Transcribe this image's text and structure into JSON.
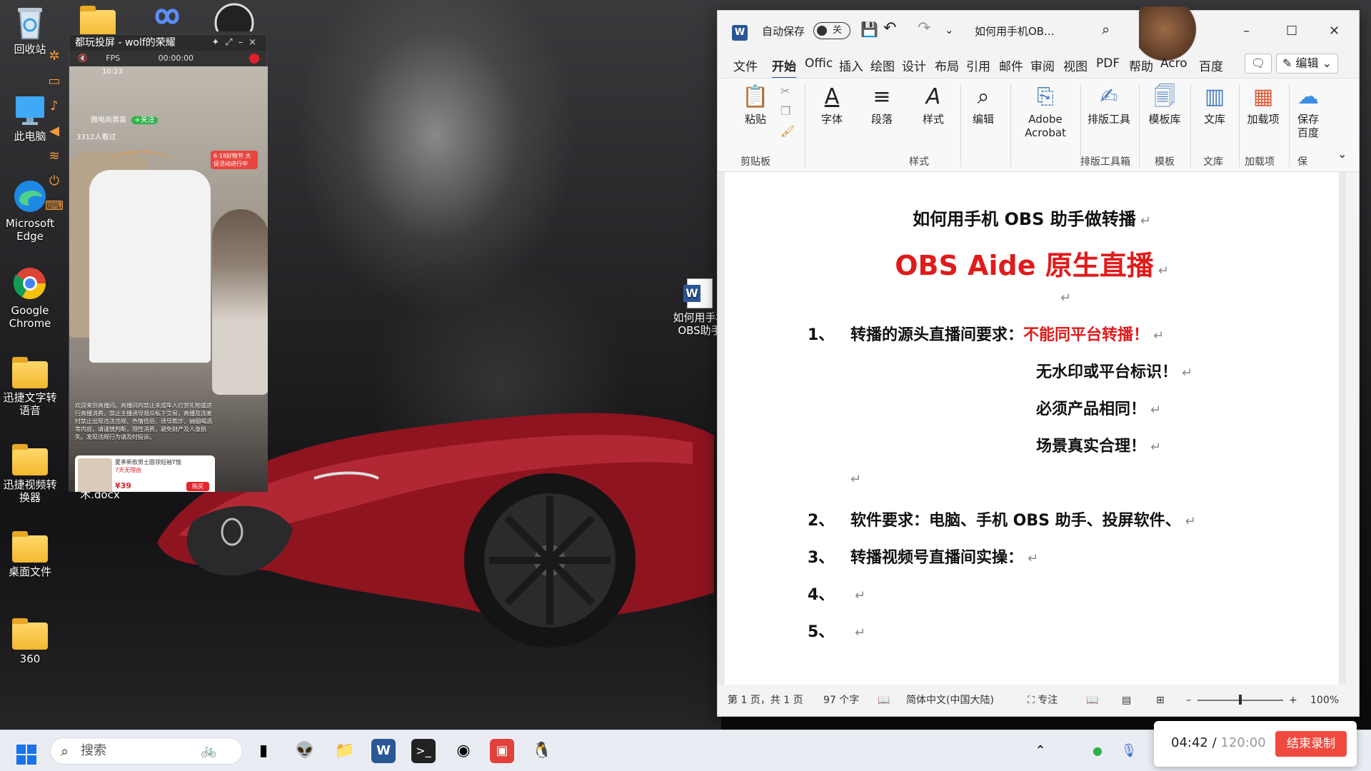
{
  "desktop": {
    "icons": [
      {
        "label": "回收站",
        "name": "recycle-bin"
      },
      {
        "label": "此电脑",
        "name": "this-pc"
      },
      {
        "label": "Microsoft Edge",
        "name": "edge"
      },
      {
        "label": "Google Chrome",
        "name": "chrome"
      },
      {
        "label": "迅捷文字转语音",
        "name": "folder-tts"
      },
      {
        "label": "迅捷视频转换器",
        "name": "folder-video"
      },
      {
        "label": "桌面文件",
        "name": "folder-desktop"
      },
      {
        "label": "360",
        "name": "folder-360"
      },
      {
        "label": "如何用手机OBS助手",
        "name": "word-doc"
      },
      {
        "label": "技巧话术.docx",
        "name": "docx-file"
      }
    ]
  },
  "mirror": {
    "title": "都玩投屏 - wolf的荣耀",
    "timer": "00:00:00",
    "fps": "FPS",
    "phone_time": "10:23",
    "streamer": "微电尚男装",
    "follow": "+关注",
    "viewers": "3312人看过",
    "promo": "6·18好物节 大促活动进行中",
    "notice": "欢迎来到直播间。直播间内禁止未成年人打赏礼物或进行直播消费，禁止主播诱导观众私下交易，直播及连麦时禁止出现违法违规、色情低俗、诱导欺诈、抽烟喝酒等内容。请谨慎判断，理性消费，避免财产及人身损失。发现违规行为请及时投诉。",
    "product_title": "夏季新款男士圆领短袖T恤",
    "product_sub": "7天无理由",
    "price": "¥39",
    "buy": "购买"
  },
  "word": {
    "autosave": "自动保存",
    "autosave_state": "关",
    "doc_name": "如何用手机OB...",
    "tabs": [
      "文件",
      "开始",
      "Offic",
      "插入",
      "绘图",
      "设计",
      "布局",
      "引用",
      "邮件",
      "审阅",
      "视图",
      "PDF",
      "帮助",
      "Acro",
      "百度"
    ],
    "edit_label": "编辑",
    "ribbon": {
      "paste": "粘贴",
      "font": "字体",
      "paragraph": "段落",
      "styles": "样式",
      "editing": "编辑",
      "acrobat": "Adobe Acrobat",
      "layout_tool": "排版工具",
      "template_lib": "模板库",
      "library": "文库",
      "addin": "加载项",
      "save_baidu": "保存百度",
      "groups": [
        "剪贴板",
        "样式",
        "排版工具箱",
        "模板",
        "文库",
        "加载项",
        "保"
      ]
    },
    "doc": {
      "title": "如何用手机 OBS 助手做转播",
      "subtitle": "OBS Aide 原生直播",
      "items": [
        {
          "num": "1、",
          "text": "转播的源头直播间要求：",
          "red": "不能同平台转播！"
        },
        {
          "num": "",
          "text": "无水印或平台标识！",
          "red": ""
        },
        {
          "num": "",
          "text": "必须产品相同！",
          "red": ""
        },
        {
          "num": "",
          "text": "场景真实合理！",
          "red": ""
        },
        {
          "num": "2、",
          "text": "软件要求：电脑、手机 OBS 助手、投屏软件、",
          "red": ""
        },
        {
          "num": "3、",
          "text": "转播视频号直播间实操：",
          "red": ""
        },
        {
          "num": "4、",
          "text": "",
          "red": ""
        },
        {
          "num": "5、",
          "text": "",
          "red": ""
        }
      ]
    },
    "status": {
      "page": "第 1 页，共 1 页",
      "words": "97 个字",
      "language": "简体中文(中国大陆)",
      "focus": "专注",
      "zoom": "100%",
      "zoom_level": 1.0
    }
  },
  "taskbar": {
    "search_placeholder": "搜索"
  },
  "recording": {
    "elapsed": "04:42",
    "total": "120:00",
    "stop": "结束录制"
  },
  "colors": {
    "accent_red": "#e01b1b",
    "word_blue": "#2b5797",
    "stop_red": "#f04a3f"
  }
}
